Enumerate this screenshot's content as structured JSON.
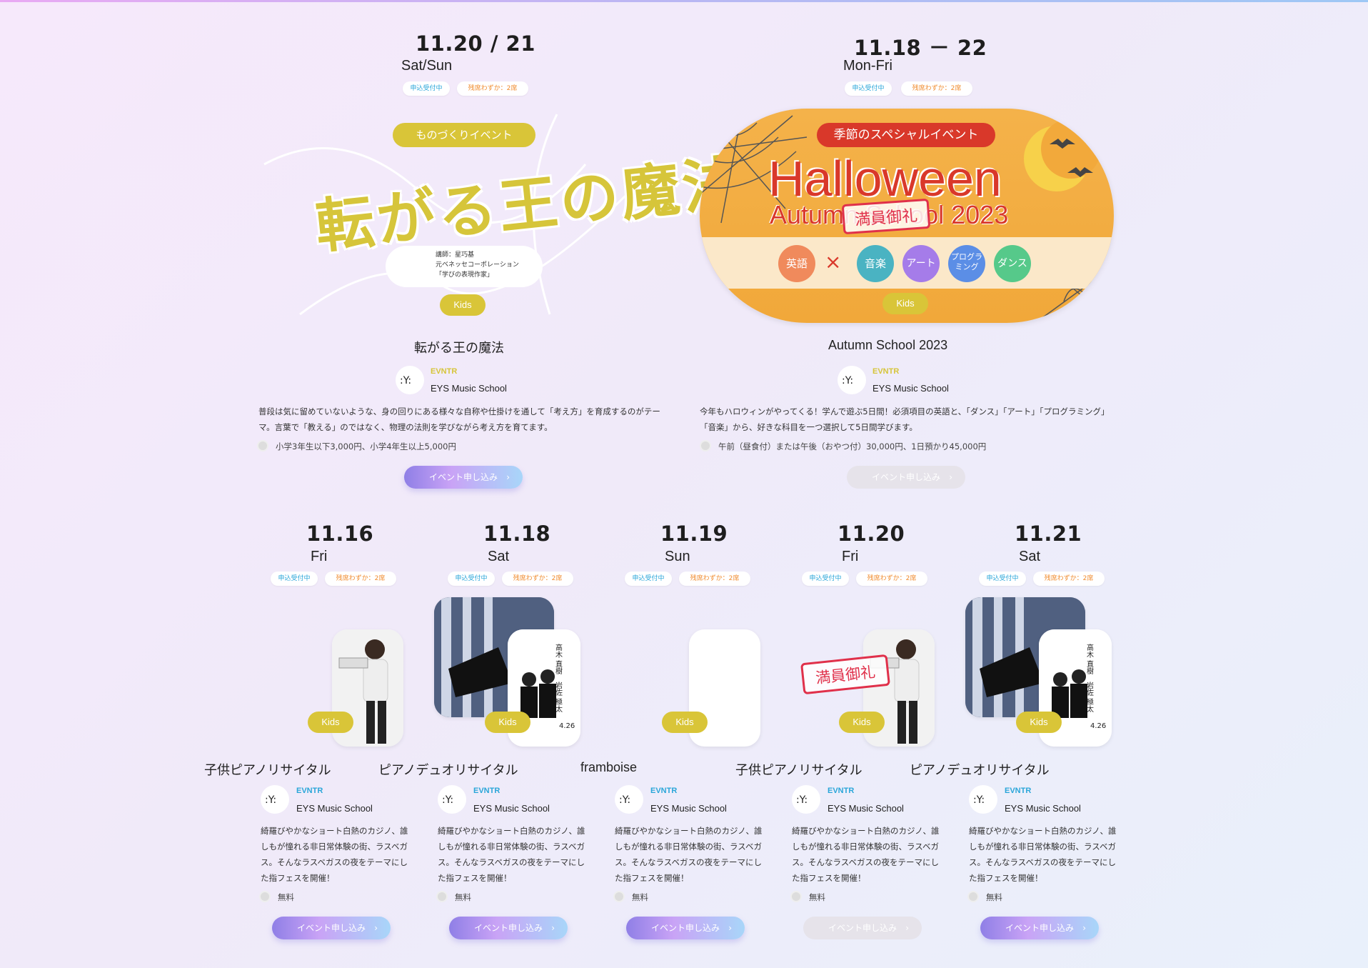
{
  "top_events": [
    {
      "date": "11.20 / 21",
      "day": "Sat/Sun",
      "tag_open": "申込受付中",
      "tag_few": "残席わずか：2席",
      "badge": "ものづくりイベント",
      "hero_title": "転がる王の魔法",
      "lecturer": [
        "講師：星巧基",
        "元ベネッセコーポレーション",
        "「学びの表現作家」"
      ],
      "kids": "Kids",
      "title": "転がる王の魔法",
      "brand": "EVNTR",
      "org": "EYS Music School",
      "desc": "普段は気に留めていないような、身の回りにある様々な自称や仕掛けを通して「考え方」を育成するのがテーマ。言葉で「教える」のではなく、物理の法則を学びながら考え方を育てます。",
      "price": "小学3年生以下3,000円、小学4年生以上5,000円",
      "button": "イベント申し込み",
      "button_enabled": true
    },
    {
      "date": "11.18 － 22",
      "day": "Mon-Fri",
      "tag_open": "申込受付中",
      "tag_few": "残席わずか：2席",
      "badge": "季節のスペシャルイベント",
      "hero_title": "Halloween",
      "hero_sub": "Autumn School 2023",
      "stamp": "満員御礼",
      "subjects": [
        "英語",
        "×",
        "音楽",
        "アート",
        "プログラミング",
        "ダンス"
      ],
      "kids": "Kids",
      "title": "Autumn School 2023",
      "brand": "EVNTR",
      "org": "EYS Music School",
      "desc": "今年もハロウィンがやってくる！学んで遊ぶ5日間！必須項目の英語と、「ダンス」「アート」「プログラミング」「音楽」から、好きな科目を一つ選択して5日間学びます。",
      "price": "午前（昼食付）または午後（おやつ付）30,000円、1日預かり45,000円",
      "button": "イベント申し込み",
      "button_enabled": false
    }
  ],
  "bottom_events": [
    {
      "date": "11.16",
      "day": "Fri",
      "tag_open": "申込受付中",
      "tag_few": "残席わずか：2席",
      "kids": "Kids",
      "title": "子供ピアノリサイタル",
      "brand": "EVNTR",
      "org": "EYS Music School",
      "desc": "綺羅びやかなショート白熱のカジノ、誰しもが憧れる非日常体験の街、ラスベガス。そんなラスベガスの夜をテーマにした指フェスを開催！",
      "price": "無料",
      "button": "イベント申し込み",
      "button_enabled": true
    },
    {
      "date": "11.18",
      "day": "Sat",
      "tag_open": "申込受付中",
      "tag_few": "残席わずか：2席",
      "kids": "Kids",
      "title": "ピアノデュオリサイタル",
      "brand": "EVNTR",
      "org": "EYS Music School",
      "desc": "綺羅びやかなショート白熱のカジノ、誰しもが憧れる非日常体験の街、ラスベガス。そんなラスベガスの夜をテーマにした指フェスを開催！",
      "price": "無料",
      "button": "イベント申し込み",
      "button_enabled": true
    },
    {
      "date": "11.19",
      "day": "Sun",
      "tag_open": "申込受付中",
      "tag_few": "残席わずか：2席",
      "kids": "Kids",
      "title": "framboise",
      "brand": "EVNTR",
      "org": "EYS Music School",
      "desc": "綺羅びやかなショート白熱のカジノ、誰しもが憧れる非日常体験の街、ラスベガス。そんなラスベガスの夜をテーマにした指フェスを開催！",
      "price": "無料",
      "button": "イベント申し込み",
      "button_enabled": true
    },
    {
      "date": "11.20",
      "day": "Fri",
      "tag_open": "申込受付中",
      "tag_few": "残席わずか：2席",
      "stamp": "満員御礼",
      "kids": "Kids",
      "title": "子供ピアノリサイタル",
      "brand": "EVNTR",
      "org": "EYS Music School",
      "desc": "綺羅びやかなショート白熱のカジノ、誰しもが憧れる非日常体験の街、ラスベガス。そんなラスベガスの夜をテーマにした指フェスを開催！",
      "price": "無料",
      "button": "イベント申し込み",
      "button_enabled": false
    },
    {
      "date": "11.21",
      "day": "Sat",
      "tag_open": "申込受付中",
      "tag_few": "残席わずか：2席",
      "kids": "Kids",
      "title": "ピアノデュオリサイタル",
      "brand": "EVNTR",
      "org": "EYS Music School",
      "desc": "綺羅びやかなショート白熱のカジノ、誰しもが憧れる非日常体験の街、ラスベガス。そんなラスベガスの夜をテーマにした指フェスを開催！",
      "price": "無料",
      "button": "イベント申し込み",
      "button_enabled": true
    }
  ],
  "poster_text": {
    "names": "高木 直樹　岩佐 極太",
    "date": "4.26"
  },
  "colors": {
    "kids": "#d9c538",
    "open": "#2aa6d9",
    "few": "#f08a2c",
    "brand_yellow": "#d6c53a",
    "brand_blue": "#2aa6d9",
    "stamp": "#e0304a"
  },
  "icons": [
    "arrow-right-icon",
    "coin-icon",
    "org-logo-icon",
    "x-icon"
  ]
}
